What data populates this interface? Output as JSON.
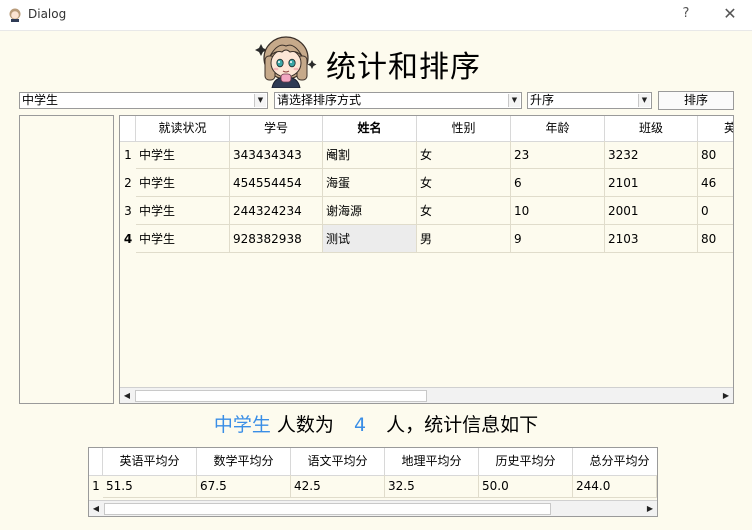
{
  "window": {
    "title": "Dialog",
    "help": "?",
    "close": "✕"
  },
  "header": {
    "title": "统计和排序"
  },
  "controls": {
    "category": "中学生",
    "sort_field": "请选择排序方式",
    "sort_order": "升序",
    "sort_button": "排序"
  },
  "main_table": {
    "columns": [
      "就读状况",
      "学号",
      "姓名",
      "性别",
      "年龄",
      "班级",
      "英"
    ],
    "row_headers": [
      "1",
      "2",
      "3",
      "4"
    ],
    "rows": [
      [
        "中学生",
        "343434343",
        "阉割",
        "女",
        "23",
        "3232",
        "80"
      ],
      [
        "中学生",
        "454554454",
        "海蛋",
        "女",
        "6",
        "2101",
        "46"
      ],
      [
        "中学生",
        "244324234",
        "谢海源",
        "女",
        "10",
        "2001",
        "0"
      ],
      [
        "中学生",
        "928382938",
        "测试",
        "男",
        "9",
        "2103",
        "80"
      ]
    ],
    "scroll_left": "◀",
    "scroll_right": "▶"
  },
  "summary": {
    "category": "中学生",
    "text1": "人数为",
    "count": "4",
    "text2": "人，统计信息如下"
  },
  "stats_table": {
    "columns": [
      "英语平均分",
      "数学平均分",
      "语文平均分",
      "地理平均分",
      "历史平均分",
      "总分平均分"
    ],
    "row_headers": [
      "1"
    ],
    "rows": [
      [
        "51.5",
        "67.5",
        "42.5",
        "32.5",
        "50.0",
        "244.0"
      ]
    ],
    "scroll_left": "◀",
    "scroll_right": "▶"
  },
  "colors": {
    "accent": "#3a8ee6",
    "background": "#fdfbee"
  }
}
